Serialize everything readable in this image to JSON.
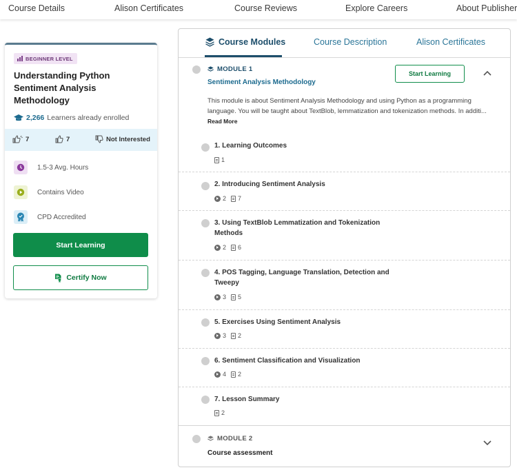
{
  "topnav": [
    "Course Details",
    "Alison Certificates",
    "Course Reviews",
    "Explore Careers",
    "About Publisher"
  ],
  "card": {
    "level": "BEGINNER LEVEL",
    "title": "Understanding Python Sentiment Analysis Methodology",
    "learners_count": "2,266",
    "learners_text": "Learners already enrolled",
    "likes": "7",
    "dislikes": "7",
    "not_interested": "Not Interested",
    "features": [
      "1.5-3 Avg. Hours",
      "Contains Video",
      "CPD Accredited"
    ],
    "start_button": "Start Learning",
    "certify_button": "Certify Now"
  },
  "tabs": [
    "Course Modules",
    "Course Description",
    "Alison Certificates"
  ],
  "module1": {
    "label": "MODULE 1",
    "name": "Sentiment Analysis Methodology",
    "button": "Start Learning",
    "description": "This module is about Sentiment Analysis Methodology and using Python as a programming language. You will be taught about TextBlob, lemmatization and tokenization methods. In additi...",
    "read_more": "Read More",
    "lessons": [
      {
        "title": "1. Learning Outcomes",
        "videos": "",
        "docs": "1"
      },
      {
        "title": "2. Introducing Sentiment Analysis",
        "videos": "2",
        "docs": "7"
      },
      {
        "title": "3. Using TextBlob Lemmatization and Tokenization Methods",
        "videos": "2",
        "docs": "6"
      },
      {
        "title": "4. POS Tagging, Language Translation, Detection and Tweepy",
        "videos": "3",
        "docs": "5"
      },
      {
        "title": "5. Exercises Using Sentiment Analysis",
        "videos": "3",
        "docs": "2"
      },
      {
        "title": "6. Sentiment Classification and Visualization",
        "videos": "4",
        "docs": "2"
      },
      {
        "title": "7. Lesson Summary",
        "videos": "",
        "docs": "2"
      }
    ]
  },
  "module2": {
    "label": "MODULE 2",
    "name": "Course assessment"
  },
  "colors": {
    "accent_green": "#0f8d4a",
    "accent_blue": "#1d4e6b",
    "link_blue": "#2a7598"
  }
}
